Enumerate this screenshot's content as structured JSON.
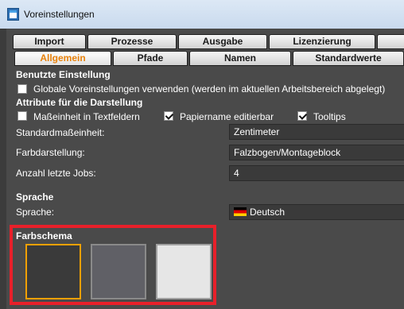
{
  "window": {
    "title": "Voreinstellungen",
    "icon": "app-preferences-icon"
  },
  "tabs": {
    "row1": [
      "Import",
      "Prozesse",
      "Ausgabe",
      "Lizenzierung"
    ],
    "row2": [
      "Allgemein",
      "Pfade",
      "Namen",
      "Standardwerte"
    ],
    "active": "Allgemein"
  },
  "user_setting": {
    "heading": "Benutzte Einstellung",
    "global_label": "Globale Voreinstellungen verwenden (werden im aktuellen Arbeitsbereich abgelegt)",
    "global_checked": false
  },
  "display": {
    "heading": "Attribute für die Darstellung",
    "units_in_fields_label": "Maßeinheit in Textfeldern",
    "units_in_fields_checked": false,
    "paper_name_editable_label": "Papiername editierbar",
    "paper_name_editable_checked": true,
    "tooltips_label": "Tooltips",
    "tooltips_checked": true,
    "unit_label": "Standardmaßeinheit:",
    "unit_value": "Zentimeter",
    "color_display_label": "Farbdarstellung:",
    "color_display_value": "Falzbogen/Montageblock",
    "recent_jobs_label": "Anzahl letzte Jobs:",
    "recent_jobs_value": "4"
  },
  "language": {
    "heading": "Sprache",
    "label": "Sprache:",
    "value": "Deutsch",
    "flag_icon": "german-flag-icon"
  },
  "color_scheme": {
    "heading": "Farbschema",
    "options": [
      "dark",
      "medium",
      "light"
    ],
    "selected": "dark",
    "colors": {
      "dark": "#3a3a3a",
      "medium": "#606066",
      "light": "#e6e6e6",
      "selection": "#f2a000",
      "highlight": "#e8202a"
    }
  }
}
